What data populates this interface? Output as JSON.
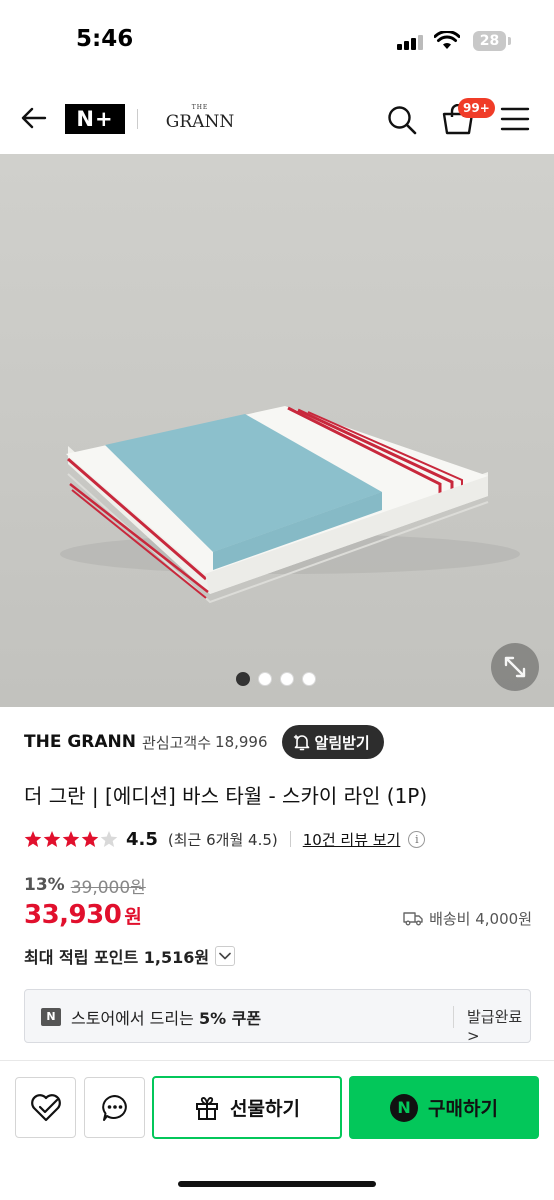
{
  "status_bar": {
    "time": "5:46",
    "battery": "28"
  },
  "header": {
    "nplus_label": "N+",
    "brand_small": "THE",
    "brand_name": "GRANN",
    "cart_badge": "99+"
  },
  "gallery": {
    "image_count": 4,
    "active_index": 0
  },
  "store": {
    "name": "THE GRANN",
    "fav_label": "관심고객수",
    "fav_count": "18,996",
    "alarm_label": "알림받기"
  },
  "product": {
    "title": "더 그란 | [에디션] 바스 타월 - 스카이 라인 (1P)",
    "rating": "4.5",
    "rating_stars": 4.5,
    "recent_rating": "(최근 6개월 4.5)",
    "review_link": "10건 리뷰 보기",
    "discount": "13%",
    "original_price": "39,000원",
    "price": "33,930",
    "price_unit": "원",
    "shipping": "배송비 4,000원",
    "points": "최대 적립 포인트 1,516원"
  },
  "coupon": {
    "badge": "N",
    "text_prefix": "스토어에서 드리는 ",
    "text_bold": "5% 쿠폰",
    "status": "발급완료 >"
  },
  "actions": {
    "gift_label": "선물하기",
    "buy_badge": "N",
    "buy_label": "구매하기"
  },
  "colors": {
    "accent_green": "#03c75a",
    "price_red": "#e1102d",
    "badge_red": "#f03c28",
    "towel_blue": "#8cc0cc",
    "towel_stripe": "#c8283c"
  }
}
